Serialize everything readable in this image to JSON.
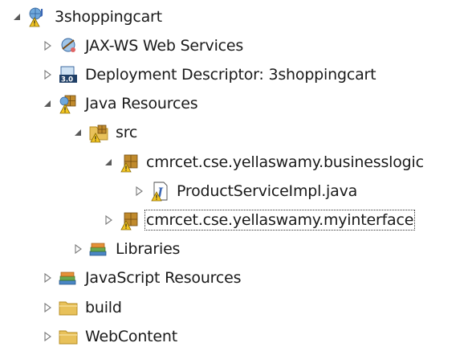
{
  "tree": {
    "items": [
      {
        "label": "3shoppingcart",
        "icon": "web-project-icon",
        "expanded": true,
        "level": 0
      },
      {
        "label": "JAX-WS Web Services",
        "icon": "jaxws-services-icon",
        "expanded": false,
        "level": 1
      },
      {
        "label": "Deployment Descriptor: 3shoppingcart",
        "icon": "deployment-descriptor-icon",
        "expanded": false,
        "level": 1
      },
      {
        "label": "Java Resources",
        "icon": "java-resources-icon",
        "expanded": true,
        "level": 1
      },
      {
        "label": "src",
        "icon": "source-folder-icon",
        "expanded": true,
        "level": 2
      },
      {
        "label": "cmrcet.cse.yellaswamy.businesslogic",
        "icon": "package-icon",
        "expanded": true,
        "level": 3
      },
      {
        "label": "ProductServiceImpl.java",
        "icon": "java-file-icon",
        "expanded": false,
        "level": 4
      },
      {
        "label": "cmrcet.cse.yellaswamy.myinterface",
        "icon": "package-icon",
        "expanded": false,
        "level": 3,
        "selected": true
      },
      {
        "label": "Libraries",
        "icon": "libraries-icon",
        "expanded": false,
        "level": 2
      },
      {
        "label": "JavaScript Resources",
        "icon": "javascript-resources-icon",
        "expanded": false,
        "level": 1
      },
      {
        "label": "build",
        "icon": "folder-icon",
        "expanded": false,
        "level": 1
      },
      {
        "label": "WebContent",
        "icon": "folder-icon",
        "expanded": false,
        "level": 1
      }
    ]
  },
  "colors": {
    "toggle": "#5a5a5a",
    "folder": "#e8c15a",
    "folder_stroke": "#b48a1e",
    "warning": "#f3c623",
    "package": "#c08a2c",
    "java_blue": "#3a66b5"
  }
}
